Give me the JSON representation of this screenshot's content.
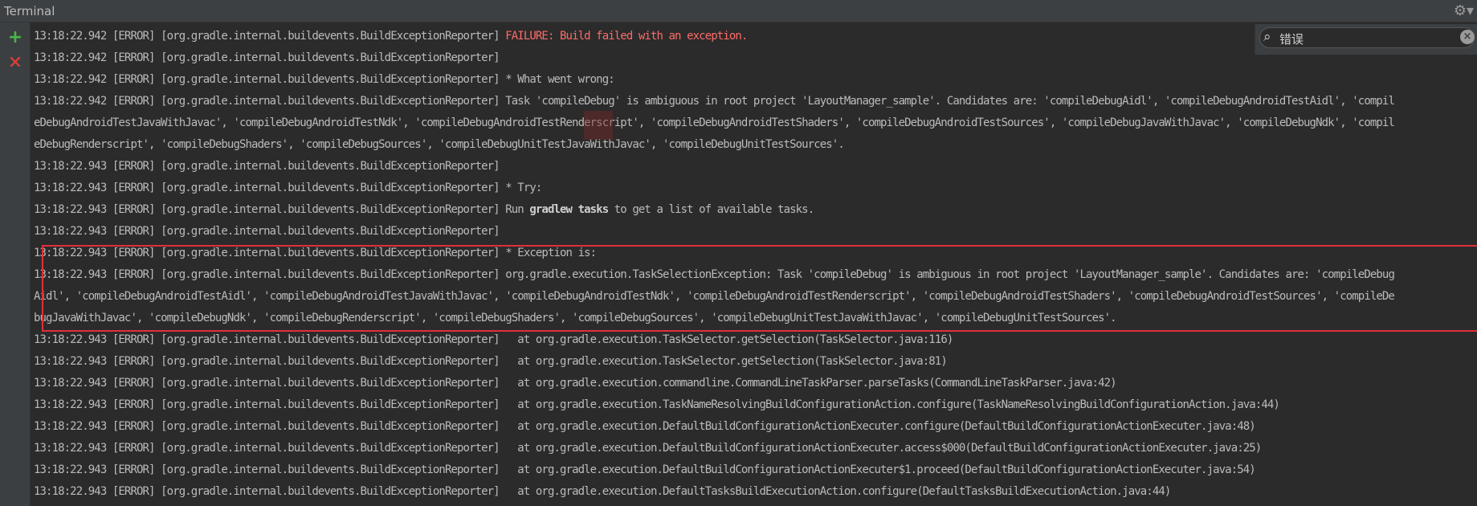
{
  "window": {
    "title": "Terminal",
    "gear_glyph": "⚙▾"
  },
  "toolbar": {
    "add_icon": "+",
    "close_icon": "✕"
  },
  "search": {
    "query": "错误",
    "icon": "🔍",
    "clear_icon": "×"
  },
  "lines": [
    {
      "prefix": "13:18:22.942 [ERROR] [org.gradle.internal.buildevents.BuildExceptionReporter] ",
      "text": "FAILURE: Build failed with an exception.",
      "style": "err"
    },
    {
      "prefix": "13:18:22.942 [ERROR] [org.gradle.internal.buildevents.BuildExceptionReporter]",
      "text": ""
    },
    {
      "prefix": "13:18:22.942 [ERROR] [org.gradle.internal.buildevents.BuildExceptionReporter] ",
      "text": "* What went wrong:"
    },
    {
      "prefix": "13:18:22.942 [ERROR] [org.gradle.internal.buildevents.BuildExceptionReporter] ",
      "text": "Task 'compileDebug' is ambiguous in root project 'LayoutManager_sample'. Candidates are: 'compileDebugAidl', 'compileDebugAndroidTestAidl', 'compil"
    },
    {
      "prefix": "",
      "text": "eDebugAndroidTestJavaWithJavac', 'compileDebugAndroidTestNdk', 'compileDebugAndroidTestRenderscript', 'compileDebugAndroidTestShaders', 'compileDebugAndroidTestSources', 'compileDebugJavaWithJavac', 'compileDebugNdk', 'compil"
    },
    {
      "prefix": "",
      "text": "eDebugRenderscript', 'compileDebugShaders', 'compileDebugSources', 'compileDebugUnitTestJavaWithJavac', 'compileDebugUnitTestSources'."
    },
    {
      "prefix": "13:18:22.943 [ERROR] [org.gradle.internal.buildevents.BuildExceptionReporter]",
      "text": ""
    },
    {
      "prefix": "13:18:22.943 [ERROR] [org.gradle.internal.buildevents.BuildExceptionReporter] ",
      "text": "* Try:"
    },
    {
      "prefix": "13:18:22.943 [ERROR] [org.gradle.internal.buildevents.BuildExceptionReporter] ",
      "text": "Run ",
      "bold": "gradlew tasks",
      "suffix": " to get a list of available tasks."
    },
    {
      "prefix": "13:18:22.943 [ERROR] [org.gradle.internal.buildevents.BuildExceptionReporter]",
      "text": ""
    },
    {
      "prefix": "13:18:22.943 [ERROR] [org.gradle.internal.buildevents.BuildExceptionReporter] ",
      "text": "* Exception is:"
    },
    {
      "prefix": "13:18:22.943 [ERROR] [org.gradle.internal.buildevents.BuildExceptionReporter] ",
      "text": "org.gradle.execution.TaskSelectionException: Task 'compileDebug' is ambiguous in root project 'LayoutManager_sample'. Candidates are: 'compileDebug"
    },
    {
      "prefix": "",
      "text": "Aidl', 'compileDebugAndroidTestAidl', 'compileDebugAndroidTestJavaWithJavac', 'compileDebugAndroidTestNdk', 'compileDebugAndroidTestRenderscript', 'compileDebugAndroidTestShaders', 'compileDebugAndroidTestSources', 'compileDe"
    },
    {
      "prefix": "",
      "text": "bugJavaWithJavac', 'compileDebugNdk', 'compileDebugRenderscript', 'compileDebugShaders', 'compileDebugSources', 'compileDebugUnitTestJavaWithJavac', 'compileDebugUnitTestSources'."
    },
    {
      "prefix": "13:18:22.943 [ERROR] [org.gradle.internal.buildevents.BuildExceptionReporter] ",
      "text": "  at org.gradle.execution.TaskSelector.getSelection(TaskSelector.java:116)"
    },
    {
      "prefix": "13:18:22.943 [ERROR] [org.gradle.internal.buildevents.BuildExceptionReporter] ",
      "text": "  at org.gradle.execution.TaskSelector.getSelection(TaskSelector.java:81)"
    },
    {
      "prefix": "13:18:22.943 [ERROR] [org.gradle.internal.buildevents.BuildExceptionReporter] ",
      "text": "  at org.gradle.execution.commandline.CommandLineTaskParser.parseTasks(CommandLineTaskParser.java:42)"
    },
    {
      "prefix": "13:18:22.943 [ERROR] [org.gradle.internal.buildevents.BuildExceptionReporter] ",
      "text": "  at org.gradle.execution.TaskNameResolvingBuildConfigurationAction.configure(TaskNameResolvingBuildConfigurationAction.java:44)"
    },
    {
      "prefix": "13:18:22.943 [ERROR] [org.gradle.internal.buildevents.BuildExceptionReporter] ",
      "text": "  at org.gradle.execution.DefaultBuildConfigurationActionExecuter.configure(DefaultBuildConfigurationActionExecuter.java:48)"
    },
    {
      "prefix": "13:18:22.943 [ERROR] [org.gradle.internal.buildevents.BuildExceptionReporter] ",
      "text": "  at org.gradle.execution.DefaultBuildConfigurationActionExecuter.access$000(DefaultBuildConfigurationActionExecuter.java:25)"
    },
    {
      "prefix": "13:18:22.943 [ERROR] [org.gradle.internal.buildevents.BuildExceptionReporter] ",
      "text": "  at org.gradle.execution.DefaultBuildConfigurationActionExecuter$1.proceed(DefaultBuildConfigurationActionExecuter.java:54)"
    },
    {
      "prefix": "13:18:22.943 [ERROR] [org.gradle.internal.buildevents.BuildExceptionReporter] ",
      "text": "  at org.gradle.execution.DefaultTasksBuildExecutionAction.configure(DefaultTasksBuildExecutionAction.java:44)"
    }
  ],
  "colors": {
    "background": "#2b2b2b",
    "text": "#bbbbbb",
    "error": "#ff6b68",
    "highlight_border": "#e0303a",
    "add": "#4ab54a",
    "close": "#e0403a"
  }
}
